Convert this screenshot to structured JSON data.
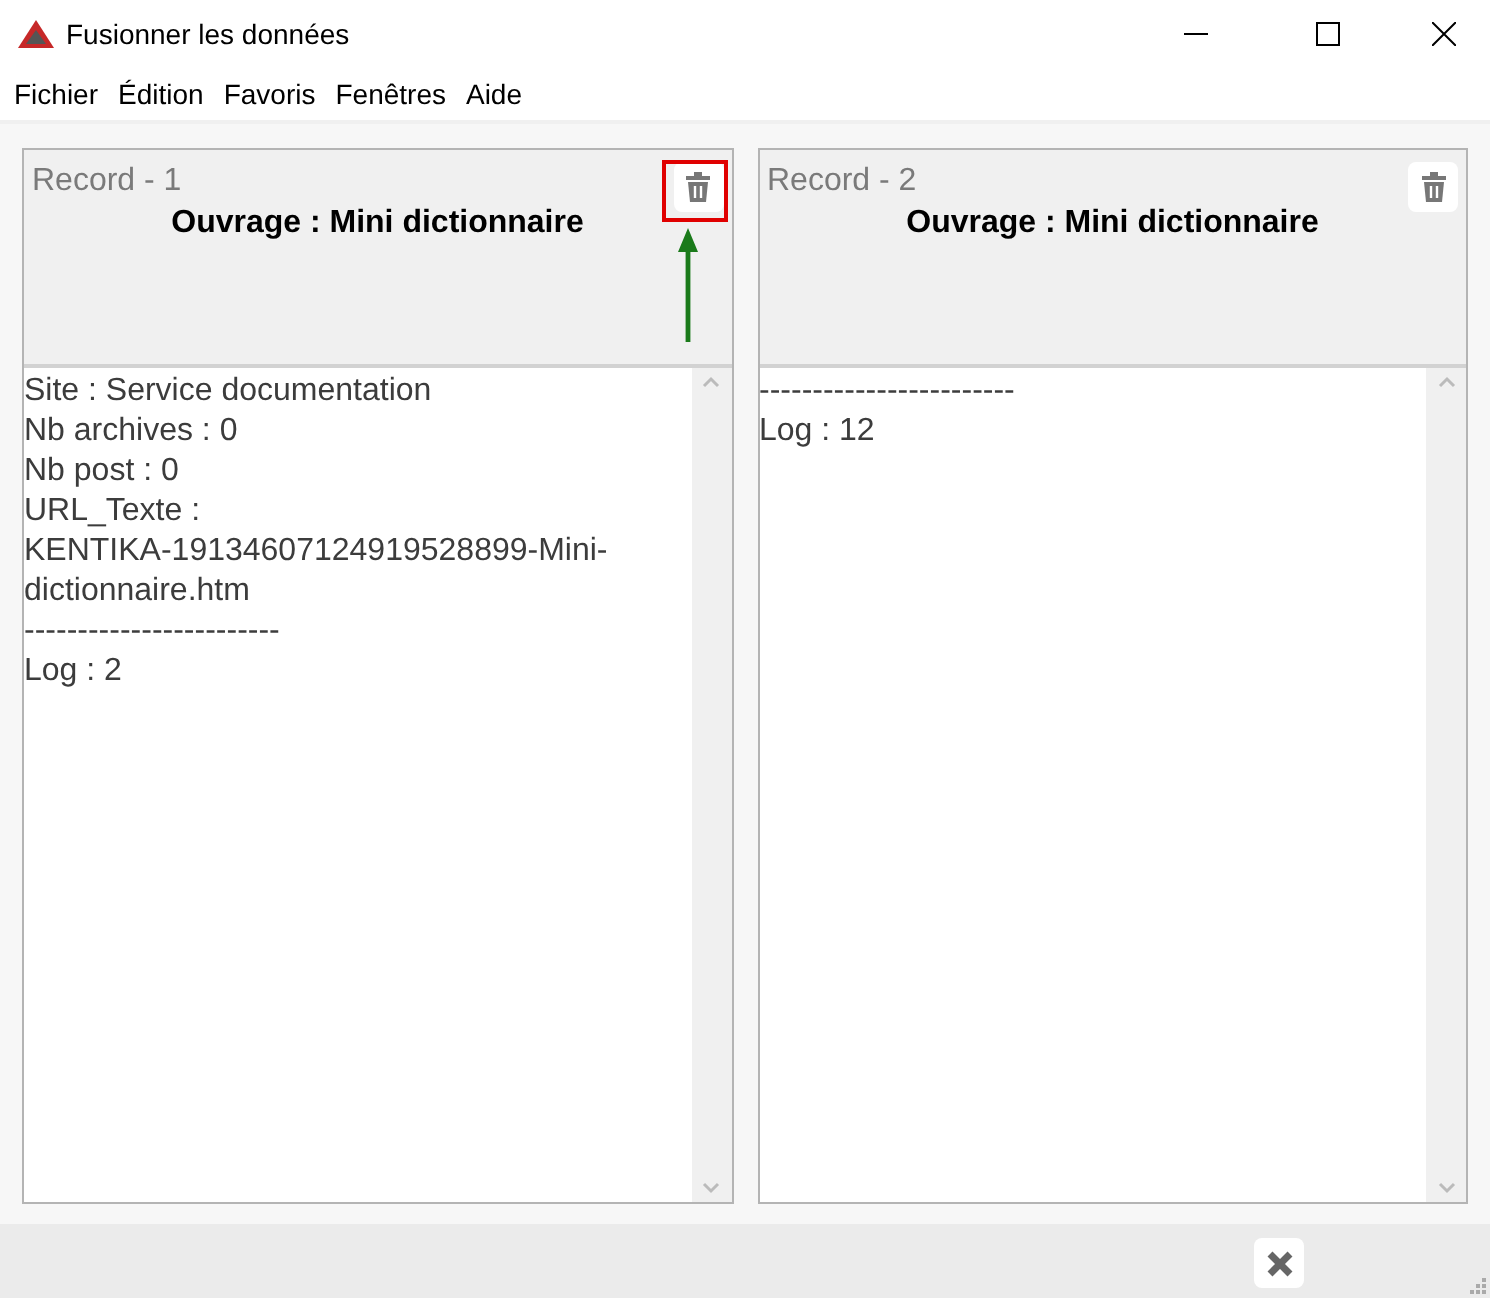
{
  "window": {
    "title": "Fusionner les données"
  },
  "menu": [
    "Fichier",
    "Édition",
    "Favoris",
    "Fenêtres",
    "Aide"
  ],
  "records": [
    {
      "label": "Record - 1",
      "title": "Ouvrage : Mini dictionnaire",
      "highlighted": true,
      "lines": [
        "Site : Service documentation",
        "Nb archives : 0",
        "Nb post : 0",
        "URL_Texte :",
        "KENTIKA-19134607124919528899-Mini-",
        "dictionnaire.htm",
        "------------------------",
        "Log : 2"
      ]
    },
    {
      "label": "Record - 2",
      "title": "Ouvrage : Mini dictionnaire",
      "highlighted": false,
      "lines": [
        "------------------------",
        "Log : 12"
      ]
    }
  ]
}
